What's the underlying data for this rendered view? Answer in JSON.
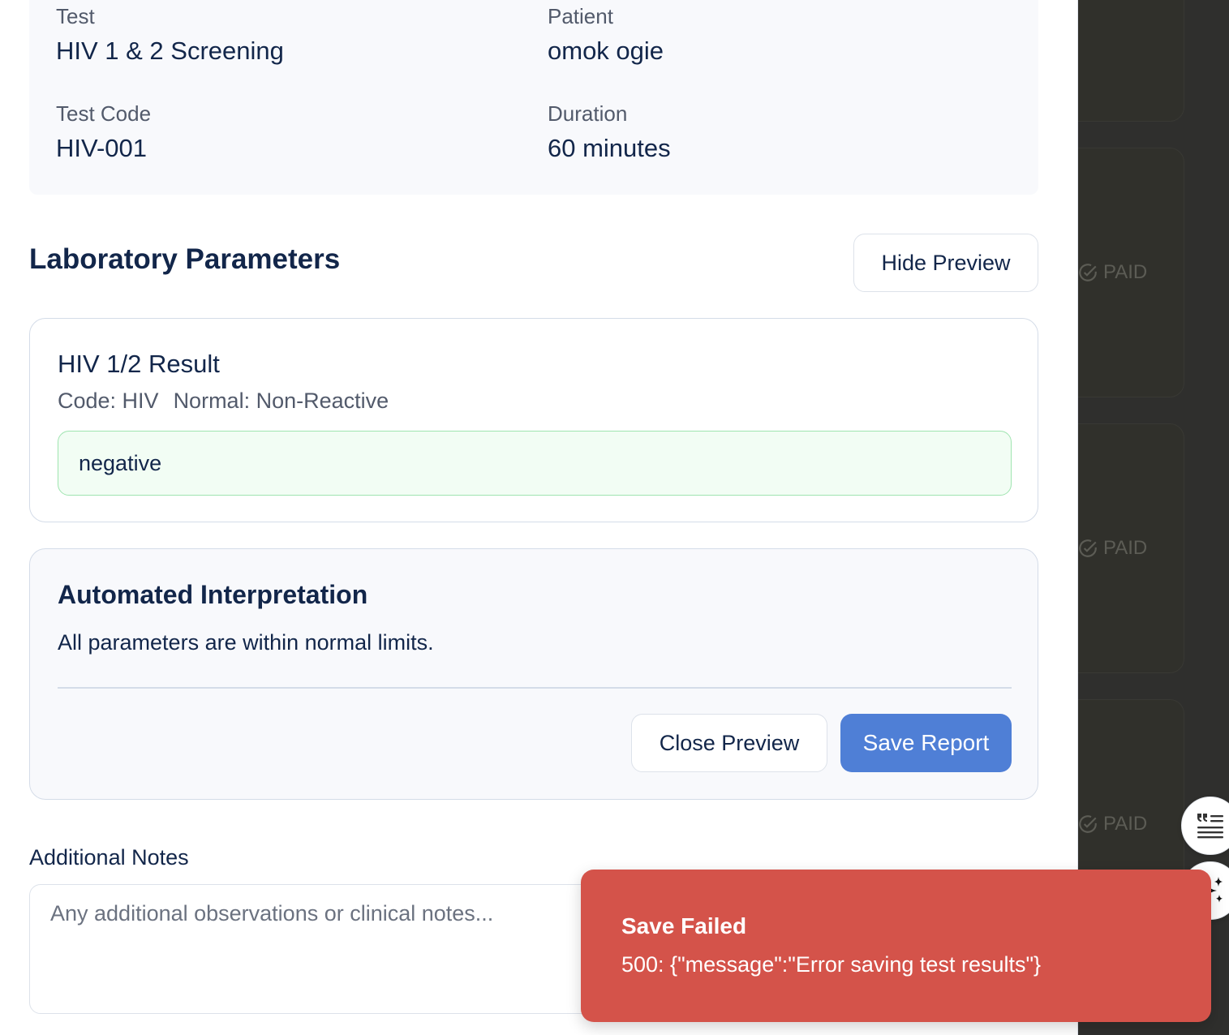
{
  "test_info": {
    "test_label": "Test",
    "test_value": "HIV 1 & 2 Screening",
    "patient_label": "Patient",
    "patient_value": "omok ogie",
    "code_label": "Test Code",
    "code_value": "HIV-001",
    "duration_label": "Duration",
    "duration_value": "60 minutes"
  },
  "lab_section": {
    "title": "Laboratory Parameters",
    "hide_preview_label": "Hide Preview"
  },
  "parameter": {
    "name": "HIV 1/2 Result",
    "code_text": "Code: HIV",
    "normal_text": "Normal: Non-Reactive",
    "value": "negative"
  },
  "interpretation": {
    "title": "Automated Interpretation",
    "text": "All parameters are within normal limits.",
    "close_preview_label": "Close Preview",
    "save_report_label": "Save Report"
  },
  "notes": {
    "label": "Additional Notes",
    "placeholder": "Any additional observations or clinical notes..."
  },
  "toast": {
    "title": "Save Failed",
    "message": "500: {\"message\":\"Error saving test results\"}"
  },
  "background": {
    "paid_labels": [
      "PAID",
      "PAID",
      "PAID"
    ]
  },
  "icons": {
    "fab_top": "quote-list-icon",
    "fab_bottom": "sparkles-icon",
    "paid": "check-circle-icon"
  },
  "colors": {
    "primary": "#4f7fd6",
    "toast_bg": "#d4534a",
    "heading": "#12264a",
    "input_success_bg": "#f2fdf4",
    "input_success_border": "#9fe4b0",
    "backdrop": "#2f2f2d"
  }
}
